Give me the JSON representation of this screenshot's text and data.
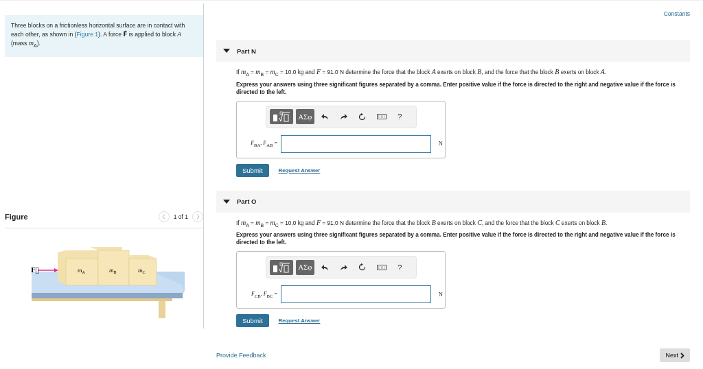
{
  "intro": {
    "before": "Three blocks on a frictionless horizontal surface are in contact with each other, as shown in (",
    "link": "Figure 1",
    "after": "). A force **F⃗** is applied to block *A* (mass *m*$_{A}$)."
  },
  "figure": {
    "title": "Figure",
    "pager": "1 of 1",
    "labels": {
      "force": "F⃗",
      "block_a": "m",
      "block_a_sub": "A",
      "block_b": "m",
      "block_b_sub": "B",
      "block_c": "m",
      "block_c_sub": "C"
    }
  },
  "constants_link": "Constants",
  "parts": [
    {
      "title": "Part N",
      "expanded": true,
      "question": "If *m*$_{A}$ = *m*$_{B}$ = *m*$_{C}$ = 10.0 kg and *F* = 91.0 N determine the force that the block *A* exerts on block *B*, and the force that the block *B* exerts on block *A*.",
      "instruction": "Express your answers using three significant figures separated by a comma. Enter positive value if the force is directed to the right and negative value if the force is directed to the left.",
      "symbols_button": "ΑΣφ",
      "help_button": "?",
      "answer_label": "*F*$_{BA}$, *F*$_{AB}$ =",
      "unit": "N",
      "submit": "Submit",
      "request": "Request Answer"
    },
    {
      "title": "Part O",
      "expanded": true,
      "question": "If *m*$_{A}$ = *m*$_{B}$ = *m*$_{C}$ = 10.0 kg and *F* = 91.0 N determine the force that the block *B* exerts on block *C*, and the force that the block *C* exerts on block *B*.",
      "instruction": "Express your answers using three significant figures separated by a comma. Enter positive value if the force is directed to the right and negative value if the force is directed to the left.",
      "symbols_button": "ΑΣφ",
      "help_button": "?",
      "answer_label": "*F*$_{CB}$, *F*$_{BC}$ =",
      "unit": "N",
      "submit": "Submit",
      "request": "Request Answer"
    }
  ],
  "feedback_link": "Provide Feedback",
  "next_button": "Next"
}
